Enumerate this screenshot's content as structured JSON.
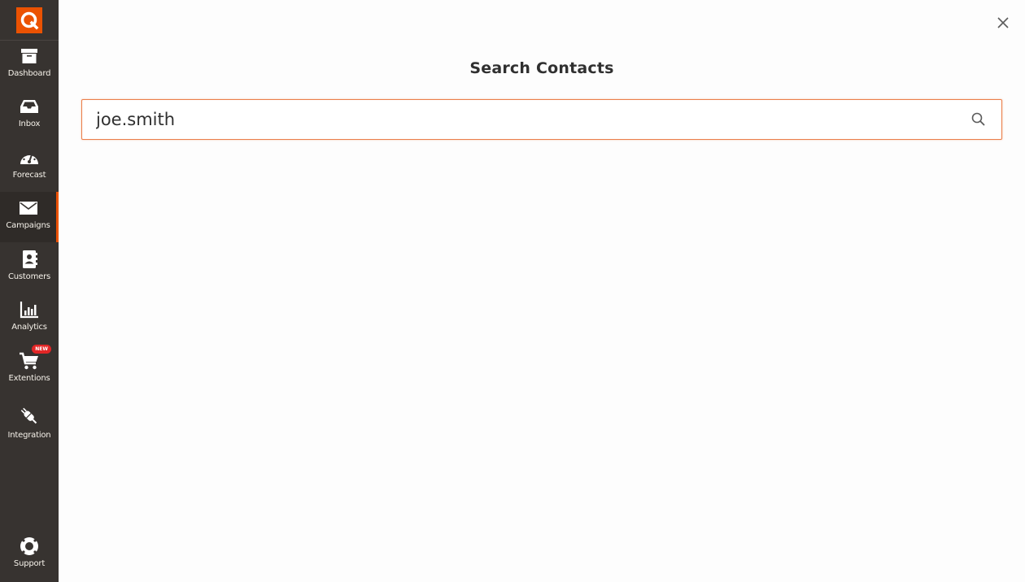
{
  "app": {
    "logo": "magento-q-logo",
    "accent_color": "#eb5202",
    "sidebar_bg": "#373330"
  },
  "sidebar": {
    "items": [
      {
        "label": "Dashboard",
        "icon": "archive-box-icon",
        "active": false
      },
      {
        "label": "Inbox",
        "icon": "inbox-tray-icon",
        "active": false
      },
      {
        "label": "Forecast",
        "icon": "speedometer-icon",
        "active": false
      },
      {
        "label": "Campaigns",
        "icon": "envelope-icon",
        "active": true
      },
      {
        "label": "Customers",
        "icon": "contact-book-icon",
        "active": false
      },
      {
        "label": "Analytics",
        "icon": "bar-chart-icon",
        "active": false
      },
      {
        "label": "Extentions",
        "icon": "shopping-cart-icon",
        "active": false,
        "badge": "NEW"
      },
      {
        "label": "Integration",
        "icon": "plug-icon",
        "active": false
      }
    ],
    "footer": {
      "label": "Support",
      "icon": "lifebuoy-icon"
    }
  },
  "modal": {
    "title": "Search Contacts",
    "search": {
      "value": "joe.smith",
      "placeholder": ""
    },
    "close_icon": "close-icon",
    "search_icon": "search-icon"
  }
}
